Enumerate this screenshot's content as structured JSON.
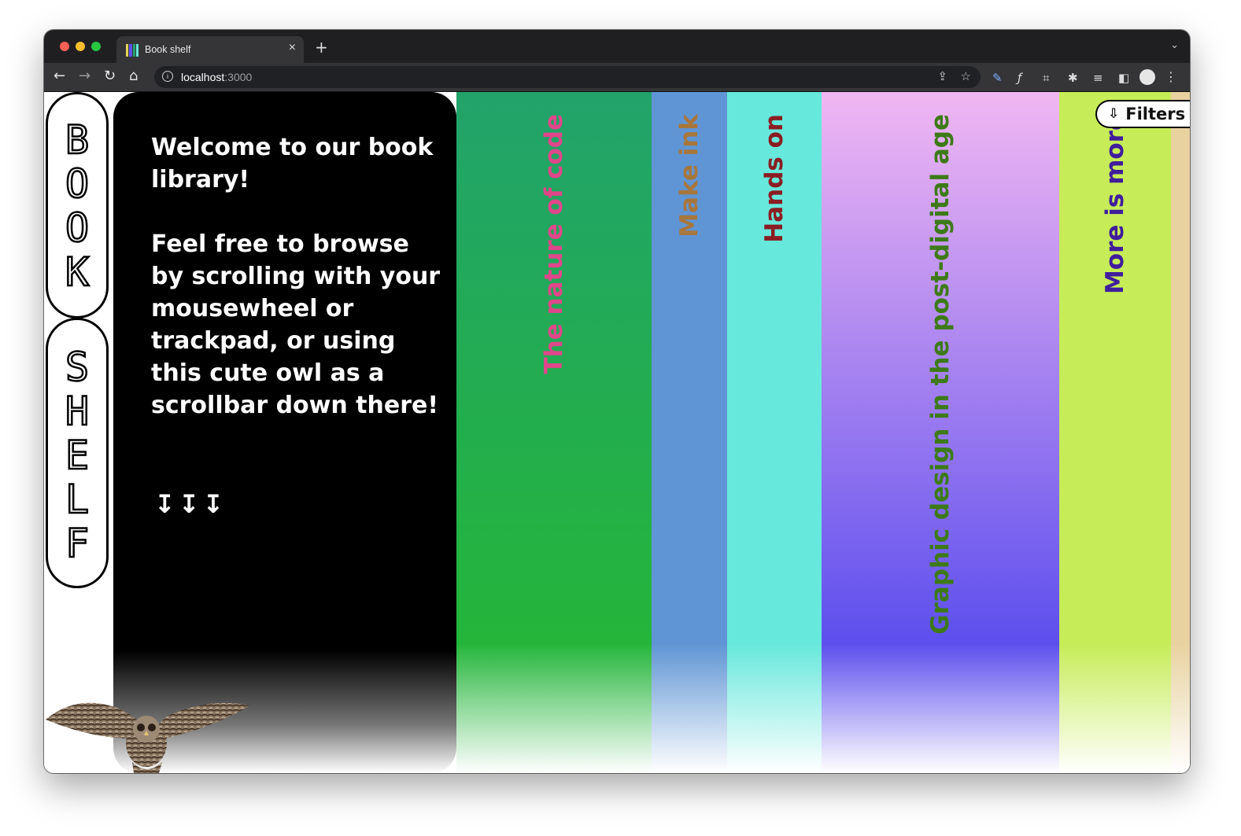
{
  "browser": {
    "tab_title": "Book shelf",
    "tab_close": "×",
    "new_tab": "+",
    "url_host": "localhost",
    "url_port": ":3000"
  },
  "site": {
    "logo_word_1": [
      "B",
      "O",
      "O",
      "K"
    ],
    "logo_word_2": [
      "S",
      "H",
      "E",
      "L",
      "F"
    ],
    "welcome_text": "Welcome to our book library!\n\nFeel free to browse by scrolling with your mousewheel or trackpad, or using this cute owl as a scrollbar down there!",
    "arrows": "↧↧↧",
    "filters_label": "Filters",
    "filters_icon": "⇩"
  },
  "books": [
    {
      "title": "The nature of code",
      "bg": "#22a36b",
      "bg_mid": "#24b53a",
      "text_color": "#e0468a"
    },
    {
      "title": "Make ink",
      "bg": "#5f95d4",
      "bg_mid": "#5f95d4",
      "text_color": "#a9763a"
    },
    {
      "title": "Hands on",
      "bg": "#67e8dc",
      "bg_mid": "#67e8dc",
      "text_color": "#8a1d22"
    },
    {
      "title": "Graphic design in the post-digital age",
      "bg_top": "#f1b7f2",
      "bg_mid": "#5d4fee",
      "text_color": "#3d7a17"
    },
    {
      "title": "More is more",
      "bg": "#c6ec57",
      "bg_mid": "#c6ec57",
      "text_color": "#3f1d9c"
    },
    {
      "title": "",
      "bg": "#e8d2a0",
      "bg_mid": "#e8d2a0",
      "text_color": "#000000"
    }
  ]
}
